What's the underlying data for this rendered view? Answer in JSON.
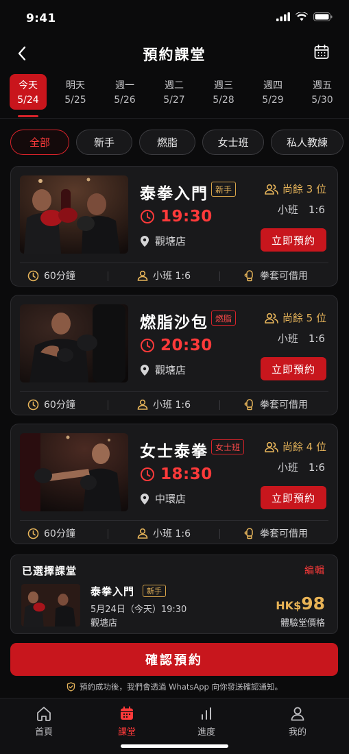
{
  "status": {
    "time": "9:41"
  },
  "header": {
    "title": "預約課堂"
  },
  "dates": [
    {
      "day": "今天",
      "date": "5/24"
    },
    {
      "day": "明天",
      "date": "5/25"
    },
    {
      "day": "週一",
      "date": "5/26"
    },
    {
      "day": "週二",
      "date": "5/27"
    },
    {
      "day": "週三",
      "date": "5/28"
    },
    {
      "day": "週四",
      "date": "5/29"
    },
    {
      "day": "週五",
      "date": "5/30"
    }
  ],
  "filters": [
    "全部",
    "新手",
    "燃脂",
    "女士班",
    "私人教練"
  ],
  "classes": [
    {
      "title": "泰拳入門",
      "tag": "新手",
      "time": "19:30",
      "location": "觀塘店",
      "spots": "尚餘 3 位",
      "size": "小班　1:6",
      "book": "立即預約",
      "duration": "60分鐘",
      "ratio": "小班 1:6",
      "gloves": "拳套可借用"
    },
    {
      "title": "燃脂沙包",
      "tag": "燃脂",
      "time": "20:30",
      "location": "觀塘店",
      "spots": "尚餘 5 位",
      "size": "小班　1:6",
      "book": "立即預約",
      "duration": "60分鐘",
      "ratio": "小班 1:6",
      "gloves": "拳套可借用"
    },
    {
      "title": "女士泰拳",
      "tag": "女士班",
      "time": "18:30",
      "location": "中環店",
      "spots": "尚餘 4 位",
      "size": "小班　1:6",
      "book": "立即預約",
      "duration": "60分鐘",
      "ratio": "小班 1:6",
      "gloves": "拳套可借用"
    }
  ],
  "selected": {
    "heading": "已選擇課堂",
    "edit": "編輯",
    "name": "泰拳入門",
    "tag": "新手",
    "datetime": "5月24日（今天）19:30",
    "location": "觀塘店",
    "currency": "HK$",
    "price": "98",
    "price_label": "體驗堂價格"
  },
  "confirm": "確認預約",
  "notice": "預約成功後，我們會透過 WhatsApp 向你發送確認通知。",
  "tabs": [
    "首頁",
    "課堂",
    "進度",
    "我的"
  ],
  "colors": {
    "accent": "#c8161d",
    "gold": "#e6b45a",
    "background": "#0b0b0c"
  }
}
